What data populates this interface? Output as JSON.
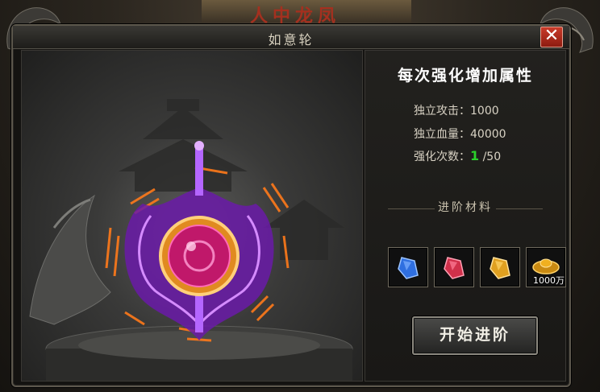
{
  "window": {
    "title": "如意轮",
    "close_label": "✕"
  },
  "background": {
    "banner_text": "人中龙凤"
  },
  "panel": {
    "heading": "每次强化增加属性",
    "stats": [
      {
        "label": "独立攻击：",
        "value": "1000"
      },
      {
        "label": "独立血量：",
        "value": "40000"
      }
    ],
    "enhance": {
      "label": "强化次数：",
      "current": "1",
      "max": "/50",
      "current_color": "#2bd02b"
    },
    "materials_header": "进阶材料",
    "materials": [
      {
        "icon": "blue-crystal-icon",
        "color": "#2f6fe0"
      },
      {
        "icon": "red-crystal-icon",
        "color": "#d0304a"
      },
      {
        "icon": "gold-crystal-icon",
        "color": "#e0a020"
      },
      {
        "icon": "gold-ingot-icon",
        "color": "#f0b020",
        "amount": "1000万"
      }
    ],
    "start_button": "开始进阶"
  },
  "colors": {
    "accent_orange": "#ff7a1a",
    "wheel_purple": "#a33cff",
    "wheel_core": "#c0186a"
  }
}
